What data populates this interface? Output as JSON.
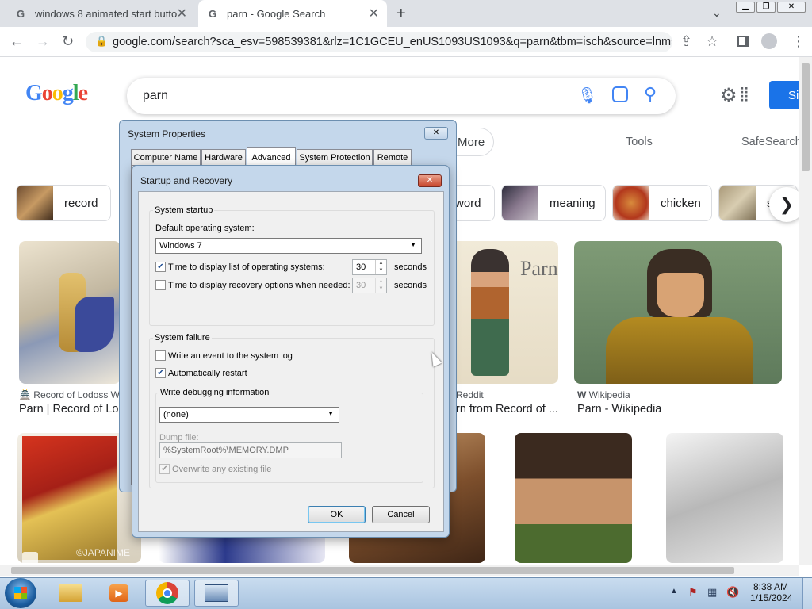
{
  "browser": {
    "tabs": [
      {
        "title": "windows 8 animated start button",
        "active": false
      },
      {
        "title": "parn - Google Search",
        "active": true
      }
    ],
    "url": "google.com/search?sca_esv=598539381&rlz=1C1GCEU_enUS1093US1093&q=parn&tbm=isch&source=lnms&s..."
  },
  "google": {
    "logo_text": "Google",
    "query": "parn",
    "filters": {
      "more": "More",
      "tools": "Tools",
      "safesearch": "SafeSearch"
    },
    "signin": "Si",
    "chips": [
      "record",
      "word",
      "meaning",
      "chicken",
      "s"
    ],
    "results_row1": [
      {
        "source": "Record of Lodoss W",
        "title": "Parn | Record of Lod"
      },
      {
        "source": "Reddit",
        "title": "rn from Record of ..."
      },
      {
        "source": "Wikipedia",
        "title": "Parn - Wikipedia"
      }
    ],
    "watermark": "©JAPANIME"
  },
  "system_properties": {
    "title": "System Properties",
    "tabs": [
      "Computer Name",
      "Hardware",
      "Advanced",
      "System Protection",
      "Remote"
    ]
  },
  "startup_recovery": {
    "title": "Startup and Recovery",
    "system_startup_label": "System startup",
    "default_os_label": "Default operating system:",
    "default_os_value": "Windows 7",
    "time_list_label": "Time to display list of operating systems:",
    "time_list_value": "30",
    "time_list_checked": true,
    "time_recovery_label": "Time to display recovery options when needed:",
    "time_recovery_value": "30",
    "time_recovery_checked": false,
    "seconds": "seconds",
    "system_failure_label": "System failure",
    "write_event_label": "Write an event to the system log",
    "write_event_checked": false,
    "auto_restart_label": "Automatically restart",
    "auto_restart_checked": true,
    "debug_info_label": "Write debugging information",
    "debug_info_value": "(none)",
    "dump_file_label": "Dump file:",
    "dump_file_value": "%SystemRoot%\\MEMORY.DMP",
    "overwrite_label": "Overwrite any existing file",
    "overwrite_checked": true,
    "ok": "OK",
    "cancel": "Cancel"
  },
  "taskbar": {
    "time": "8:38 AM",
    "date": "1/15/2024"
  },
  "icons": [
    "google-favicon",
    "close-icon",
    "plus-icon",
    "back-icon",
    "forward-icon",
    "reload-icon",
    "lock-icon",
    "share-icon",
    "star-icon",
    "sidepanel-icon",
    "profile-icon",
    "kebab-icon",
    "mic-icon",
    "lens-icon",
    "search-icon",
    "gear-icon",
    "apps-icon",
    "chevron-right-icon"
  ]
}
